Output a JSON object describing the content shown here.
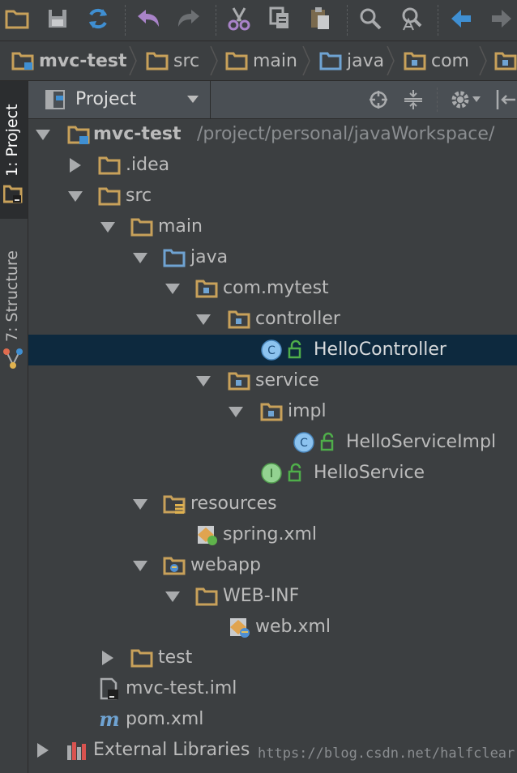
{
  "toolbar": {
    "buttons": [
      {
        "name": "open-folder",
        "icon": "folder-open-icon"
      },
      {
        "name": "save-all",
        "icon": "save-icon"
      },
      {
        "name": "synchronize",
        "icon": "sync-icon"
      },
      {
        "name": "undo",
        "icon": "undo-icon"
      },
      {
        "name": "redo",
        "icon": "redo-icon"
      },
      {
        "name": "cut",
        "icon": "scissors-icon"
      },
      {
        "name": "copy",
        "icon": "copy-icon"
      },
      {
        "name": "paste",
        "icon": "paste-icon"
      },
      {
        "name": "find",
        "icon": "search-icon"
      },
      {
        "name": "replace",
        "icon": "find-replace-icon"
      },
      {
        "name": "back",
        "icon": "arrow-left-icon"
      },
      {
        "name": "forward",
        "icon": "arrow-right-icon"
      }
    ]
  },
  "breadcrumbs": [
    "mvc-test",
    "src",
    "main",
    "java",
    "com"
  ],
  "side_tabs": {
    "project": "1: Project",
    "structure": "7: Structure"
  },
  "panel": {
    "title": "Project"
  },
  "tree": {
    "root_name": "mvc-test",
    "root_path": "/project/personal/javaWorkspace/",
    "idea": ".idea",
    "src": "src",
    "main": "main",
    "java": "java",
    "package": "com.mytest",
    "controller": "controller",
    "hello_controller": "HelloController",
    "service": "service",
    "impl": "impl",
    "hello_service_impl": "HelloServiceImpl",
    "hello_service": "HelloService",
    "resources": "resources",
    "spring_xml": "spring.xml",
    "webapp": "webapp",
    "web_inf": "WEB-INF",
    "web_xml": "web.xml",
    "test": "test",
    "iml": "mvc-test.iml",
    "pom": "pom.xml",
    "external_libraries": "External Libraries"
  },
  "class_badge": "C",
  "interface_badge": "I",
  "watermark": "https://blog.csdn.net/halfclear",
  "colors": {
    "background": "#3c3f41",
    "selection": "#0d293e",
    "folder": "#c8a15a",
    "source_folder": "#6fa3d2",
    "class_badge": "#8cc3ef",
    "interface_badge": "#93d291",
    "lock": "#4fae4a"
  }
}
